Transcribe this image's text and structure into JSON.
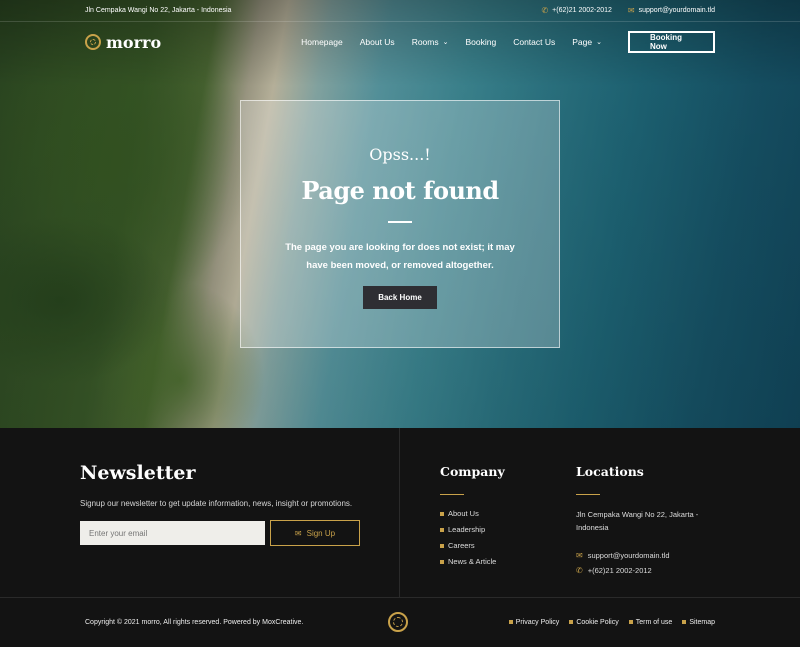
{
  "topbar": {
    "address": "Jln Cempaka Wangi No 22, Jakarta - Indonesia",
    "phone": "+(62)21 2002-2012",
    "email": "support@yourdomain.tld"
  },
  "brand": {
    "name": "morro"
  },
  "nav": {
    "items": [
      {
        "label": "Homepage"
      },
      {
        "label": "About Us"
      },
      {
        "label": "Rooms",
        "dropdown": true
      },
      {
        "label": "Booking"
      },
      {
        "label": "Contact Us"
      },
      {
        "label": "Page",
        "dropdown": true
      }
    ],
    "cta": "Booking Now"
  },
  "error": {
    "kicker": "Opss...!",
    "title": "Page not found",
    "message": "The page you are looking for does not exist; it may have been moved, or removed altogether.",
    "button": "Back Home"
  },
  "newsletter": {
    "title": "Newsletter",
    "text": "Signup our newsletter to get update information, news, insight or promotions.",
    "placeholder": "Enter your email",
    "button": "Sign Up"
  },
  "company": {
    "title": "Company",
    "links": [
      "About Us",
      "Leadership",
      "Careers",
      "News & Article"
    ]
  },
  "locations": {
    "title": "Locations",
    "address": "Jln Cempaka Wangi No 22, Jakarta - Indonesia",
    "email": "support@yourdomain.tld",
    "phone": "+(62)21 2002-2012"
  },
  "bottom": {
    "copyright": "Copyright © 2021 morro, All rights reserved. Powered by MoxCreative.",
    "links": [
      "Privacy Policy",
      "Cookie Policy",
      "Term of use",
      "Sitemap"
    ]
  },
  "colors": {
    "accent": "#c9a24a",
    "footer_bg": "#131313",
    "button_dark": "#2e2e33"
  }
}
